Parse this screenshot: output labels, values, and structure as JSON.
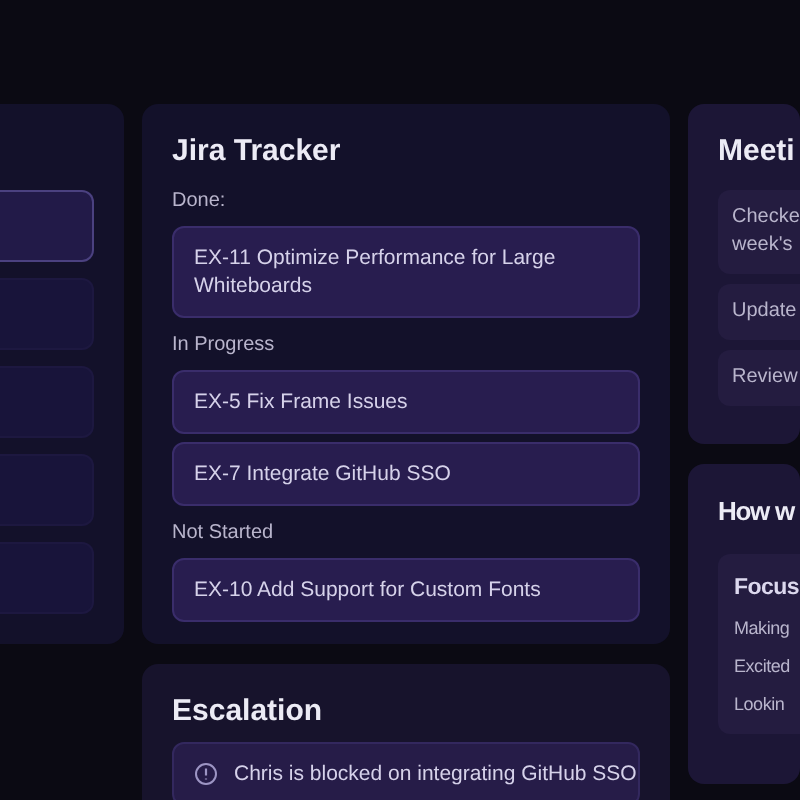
{
  "left_panel": {
    "items": [
      {
        "selected": true
      },
      {
        "selected": false
      },
      {
        "selected": false
      },
      {
        "selected": false
      },
      {
        "selected": false
      }
    ]
  },
  "jira_tracker": {
    "title": "Jira Tracker",
    "groups": [
      {
        "label": "Done:",
        "tickets": [
          "EX-11 Optimize Performance for Large Whiteboards"
        ]
      },
      {
        "label": "In Progress",
        "tickets": [
          "EX-5 Fix Frame Issues",
          "EX-7 Integrate GitHub SSO"
        ]
      },
      {
        "label": "Not Started",
        "tickets": [
          "EX-10 Add Support for Custom Fonts"
        ]
      }
    ]
  },
  "escalation": {
    "title": "Escalation",
    "items": [
      "Chris is blocked on integrating GitHub SSO"
    ]
  },
  "meeting": {
    "title": "Meeti",
    "items": [
      [
        "Checke",
        "week's"
      ],
      [
        "Update"
      ],
      [
        "Review"
      ]
    ]
  },
  "how": {
    "title": "How w",
    "panel": {
      "heading": "Focus",
      "lines": [
        "Making",
        "Excited",
        "Lookin"
      ]
    }
  }
}
